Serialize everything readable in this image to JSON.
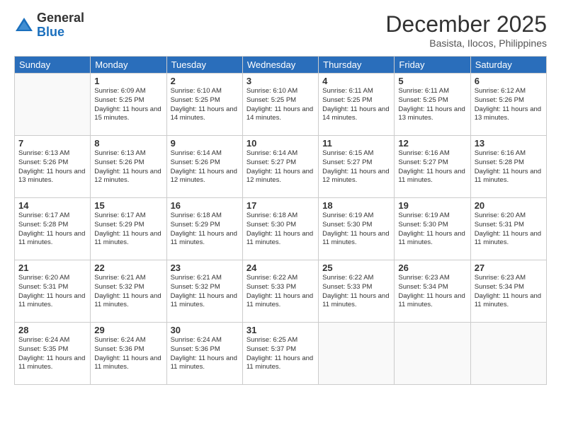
{
  "header": {
    "logo_general": "General",
    "logo_blue": "Blue",
    "month": "December 2025",
    "location": "Basista, Ilocos, Philippines"
  },
  "days_of_week": [
    "Sunday",
    "Monday",
    "Tuesday",
    "Wednesday",
    "Thursday",
    "Friday",
    "Saturday"
  ],
  "weeks": [
    [
      {
        "day": "",
        "info": ""
      },
      {
        "day": "1",
        "info": "Sunrise: 6:09 AM\nSunset: 5:25 PM\nDaylight: 11 hours\nand 15 minutes."
      },
      {
        "day": "2",
        "info": "Sunrise: 6:10 AM\nSunset: 5:25 PM\nDaylight: 11 hours\nand 14 minutes."
      },
      {
        "day": "3",
        "info": "Sunrise: 6:10 AM\nSunset: 5:25 PM\nDaylight: 11 hours\nand 14 minutes."
      },
      {
        "day": "4",
        "info": "Sunrise: 6:11 AM\nSunset: 5:25 PM\nDaylight: 11 hours\nand 14 minutes."
      },
      {
        "day": "5",
        "info": "Sunrise: 6:11 AM\nSunset: 5:25 PM\nDaylight: 11 hours\nand 13 minutes."
      },
      {
        "day": "6",
        "info": "Sunrise: 6:12 AM\nSunset: 5:26 PM\nDaylight: 11 hours\nand 13 minutes."
      }
    ],
    [
      {
        "day": "7",
        "info": "Sunrise: 6:13 AM\nSunset: 5:26 PM\nDaylight: 11 hours\nand 13 minutes."
      },
      {
        "day": "8",
        "info": "Sunrise: 6:13 AM\nSunset: 5:26 PM\nDaylight: 11 hours\nand 12 minutes."
      },
      {
        "day": "9",
        "info": "Sunrise: 6:14 AM\nSunset: 5:26 PM\nDaylight: 11 hours\nand 12 minutes."
      },
      {
        "day": "10",
        "info": "Sunrise: 6:14 AM\nSunset: 5:27 PM\nDaylight: 11 hours\nand 12 minutes."
      },
      {
        "day": "11",
        "info": "Sunrise: 6:15 AM\nSunset: 5:27 PM\nDaylight: 11 hours\nand 12 minutes."
      },
      {
        "day": "12",
        "info": "Sunrise: 6:16 AM\nSunset: 5:27 PM\nDaylight: 11 hours\nand 11 minutes."
      },
      {
        "day": "13",
        "info": "Sunrise: 6:16 AM\nSunset: 5:28 PM\nDaylight: 11 hours\nand 11 minutes."
      }
    ],
    [
      {
        "day": "14",
        "info": "Sunrise: 6:17 AM\nSunset: 5:28 PM\nDaylight: 11 hours\nand 11 minutes."
      },
      {
        "day": "15",
        "info": "Sunrise: 6:17 AM\nSunset: 5:29 PM\nDaylight: 11 hours\nand 11 minutes."
      },
      {
        "day": "16",
        "info": "Sunrise: 6:18 AM\nSunset: 5:29 PM\nDaylight: 11 hours\nand 11 minutes."
      },
      {
        "day": "17",
        "info": "Sunrise: 6:18 AM\nSunset: 5:30 PM\nDaylight: 11 hours\nand 11 minutes."
      },
      {
        "day": "18",
        "info": "Sunrise: 6:19 AM\nSunset: 5:30 PM\nDaylight: 11 hours\nand 11 minutes."
      },
      {
        "day": "19",
        "info": "Sunrise: 6:19 AM\nSunset: 5:30 PM\nDaylight: 11 hours\nand 11 minutes."
      },
      {
        "day": "20",
        "info": "Sunrise: 6:20 AM\nSunset: 5:31 PM\nDaylight: 11 hours\nand 11 minutes."
      }
    ],
    [
      {
        "day": "21",
        "info": "Sunrise: 6:20 AM\nSunset: 5:31 PM\nDaylight: 11 hours\nand 11 minutes."
      },
      {
        "day": "22",
        "info": "Sunrise: 6:21 AM\nSunset: 5:32 PM\nDaylight: 11 hours\nand 11 minutes."
      },
      {
        "day": "23",
        "info": "Sunrise: 6:21 AM\nSunset: 5:32 PM\nDaylight: 11 hours\nand 11 minutes."
      },
      {
        "day": "24",
        "info": "Sunrise: 6:22 AM\nSunset: 5:33 PM\nDaylight: 11 hours\nand 11 minutes."
      },
      {
        "day": "25",
        "info": "Sunrise: 6:22 AM\nSunset: 5:33 PM\nDaylight: 11 hours\nand 11 minutes."
      },
      {
        "day": "26",
        "info": "Sunrise: 6:23 AM\nSunset: 5:34 PM\nDaylight: 11 hours\nand 11 minutes."
      },
      {
        "day": "27",
        "info": "Sunrise: 6:23 AM\nSunset: 5:34 PM\nDaylight: 11 hours\nand 11 minutes."
      }
    ],
    [
      {
        "day": "28",
        "info": "Sunrise: 6:24 AM\nSunset: 5:35 PM\nDaylight: 11 hours\nand 11 minutes."
      },
      {
        "day": "29",
        "info": "Sunrise: 6:24 AM\nSunset: 5:36 PM\nDaylight: 11 hours\nand 11 minutes."
      },
      {
        "day": "30",
        "info": "Sunrise: 6:24 AM\nSunset: 5:36 PM\nDaylight: 11 hours\nand 11 minutes."
      },
      {
        "day": "31",
        "info": "Sunrise: 6:25 AM\nSunset: 5:37 PM\nDaylight: 11 hours\nand 11 minutes."
      },
      {
        "day": "",
        "info": ""
      },
      {
        "day": "",
        "info": ""
      },
      {
        "day": "",
        "info": ""
      }
    ]
  ]
}
